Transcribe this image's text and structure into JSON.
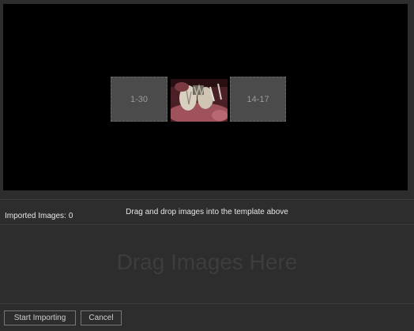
{
  "template": {
    "slots": [
      {
        "label": "1-30"
      },
      {
        "label": "14-17"
      }
    ],
    "filled_slot_icon": "dental-photo-thumbnail"
  },
  "status": {
    "imported_label": "Imported Images:",
    "imported_count": "0",
    "instruction": "Drag and drop images into the template above"
  },
  "dropzone": {
    "text": "Drag Images Here"
  },
  "buttons": {
    "start_label": "Start Importing",
    "cancel_label": "Cancel"
  },
  "colors": {
    "background": "#2d2d2d",
    "preview_background": "#000000",
    "slot_fill": "#4b4b4b"
  }
}
